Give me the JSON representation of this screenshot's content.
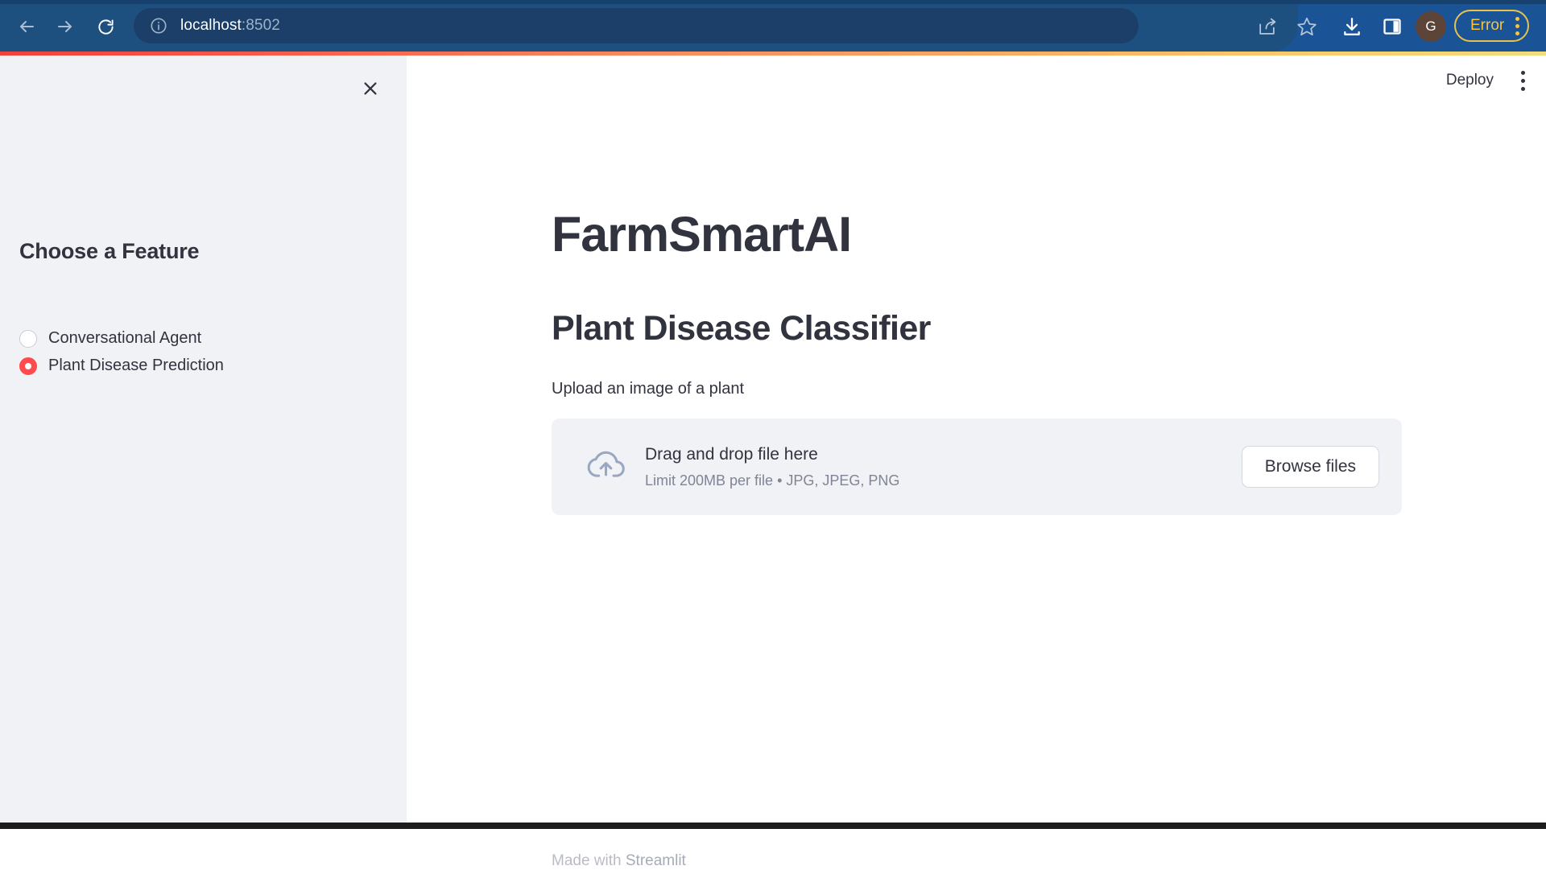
{
  "browser": {
    "url_host": "localhost",
    "url_port": ":8502",
    "back_icon": "arrow-left-icon",
    "forward_icon": "arrow-right-icon",
    "reload_icon": "reload-icon",
    "site_info_icon": "info-circle-icon",
    "share_icon": "share-icon",
    "bookmark_icon": "star-icon",
    "download_icon": "download-icon",
    "panel_icon": "side-panel-icon",
    "profile_initial": "G",
    "error_label": "Error",
    "kebab_icon": "kebab-menu-icon",
    "chrome_bg": "#1a5497",
    "error_accent": "#f5c542"
  },
  "accent": {
    "gradient_start": "#f0423c",
    "gradient_end": "#f2dc7a"
  },
  "sidebar": {
    "close_icon": "close-icon",
    "title": "Choose a Feature",
    "radio_options": [
      {
        "label": "Conversational Agent",
        "selected": false
      },
      {
        "label": "Plant Disease Prediction",
        "selected": true
      }
    ],
    "selected_color": "#ff4b4b",
    "background": "#f0f2f6"
  },
  "main": {
    "deploy_label": "Deploy",
    "kebab_icon": "kebab-menu-icon",
    "app_title": "FarmSmartAI",
    "section_title": "Plant Disease Classifier",
    "upload_label": "Upload an image of a plant",
    "uploader": {
      "cloud_icon": "cloud-upload-icon",
      "primary_text": "Drag and drop file here",
      "secondary_text": "Limit 200MB per file • JPG, JPEG, PNG",
      "browse_button": "Browse files"
    },
    "footer_prefix": "Made with ",
    "footer_brand": "Streamlit"
  }
}
